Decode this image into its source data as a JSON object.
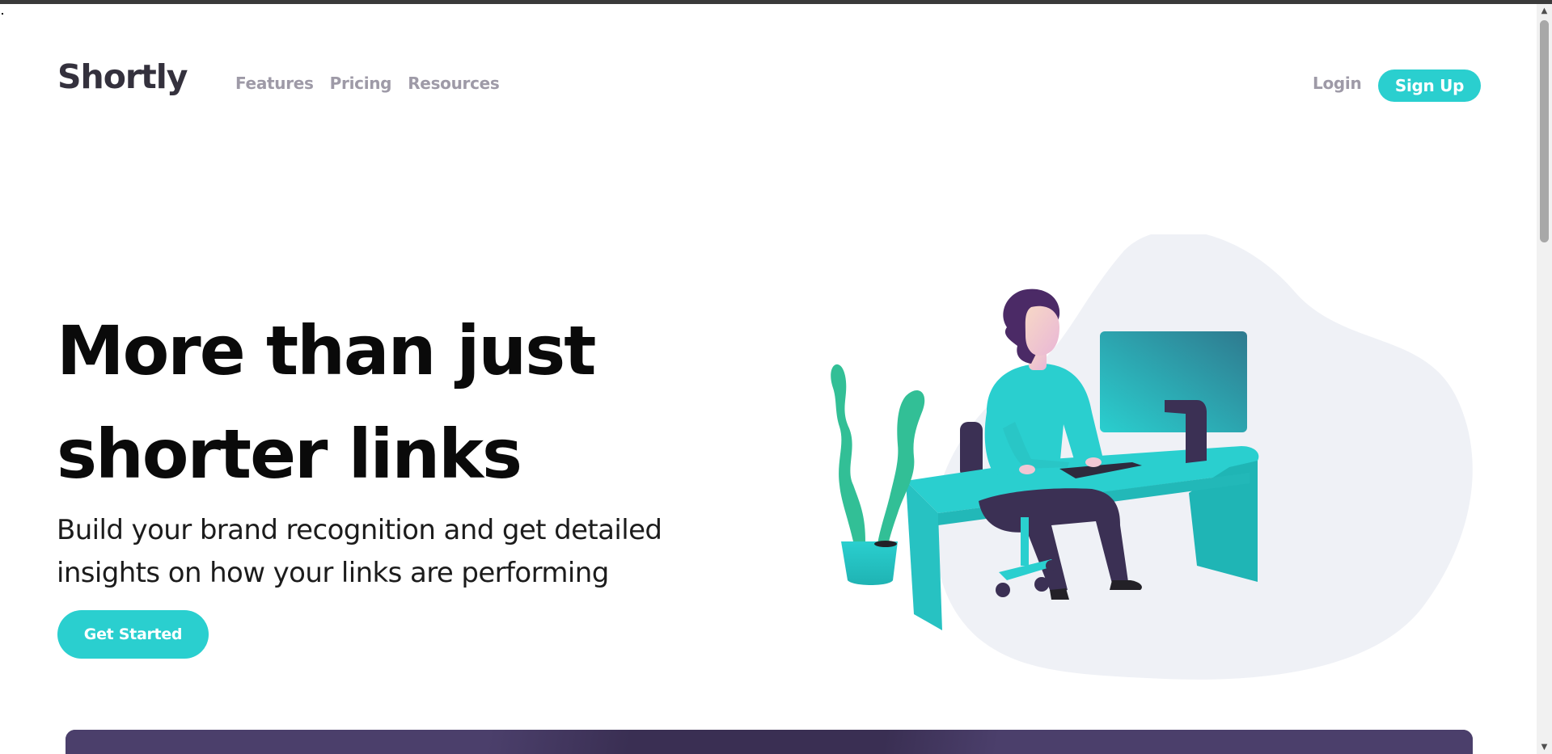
{
  "header": {
    "logo": "Shortly",
    "nav": [
      "Features",
      "Pricing",
      "Resources"
    ],
    "login_label": "Login",
    "signup_label": "Sign Up"
  },
  "hero": {
    "title_line1": "More than just",
    "title_line2": "shorter links",
    "subtitle_line1": "Build your brand recognition and get detailed",
    "subtitle_line2": "insights on how your links are performing",
    "cta_label": "Get Started"
  },
  "colors": {
    "accent": "#2acfcf",
    "dark_violet": "#3b3054",
    "grayish_violet": "#9e9aa7",
    "very_dark_blue": "#34313d"
  },
  "scrollbar": {
    "up_icon": "chevron-up-icon",
    "down_icon": "chevron-down-icon"
  }
}
